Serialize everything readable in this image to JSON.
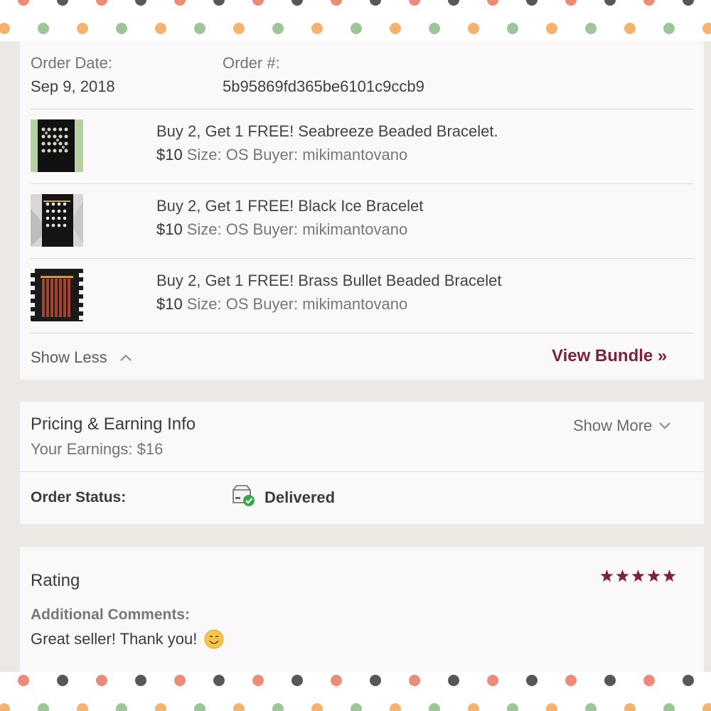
{
  "order": {
    "date_label": "Order Date:",
    "date_value": "Sep 9, 2018",
    "number_label": "Order #:",
    "number_value": "5b95869fd365be6101c9ccb9"
  },
  "items": [
    {
      "title": "Buy 2, Get 1 FREE! Seabreeze Beaded Bracelet.",
      "price": "$10",
      "size": "Size: OS",
      "buyer": "Buyer: mikimantovano"
    },
    {
      "title": "Buy 2, Get 1 FREE! Black Ice Bracelet",
      "price": "$10",
      "size": "Size: OS",
      "buyer": "Buyer: mikimantovano"
    },
    {
      "title": "Buy 2, Get 1 FREE! Brass Bullet Beaded Bracelet",
      "price": "$10",
      "size": "Size: OS",
      "buyer": "Buyer: mikimantovano"
    }
  ],
  "bundle": {
    "show_less": "Show Less",
    "view_bundle": "View Bundle »"
  },
  "pricing": {
    "title": "Pricing & Earning Info",
    "earnings": "Your Earnings: $16",
    "show_more": "Show More",
    "status_label": "Order Status:",
    "status_value": "Delivered"
  },
  "rating": {
    "title": "Rating",
    "stars": 5,
    "comments_label": "Additional Comments:",
    "comments_value": "Great seller! Thank you!"
  },
  "colors": {
    "accent": "#7c2435",
    "status_green": "#3aa64a"
  }
}
